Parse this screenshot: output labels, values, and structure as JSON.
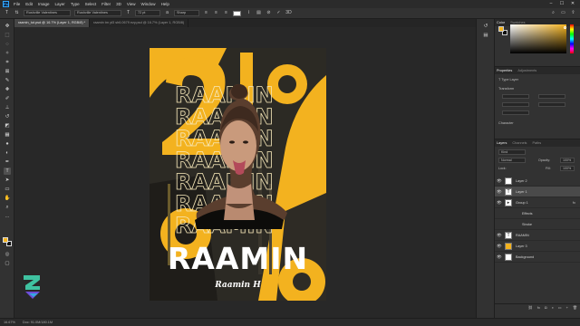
{
  "app": {
    "logo": "Ps",
    "menu": [
      "File",
      "Edit",
      "Image",
      "Layer",
      "Type",
      "Select",
      "Filter",
      "3D",
      "View",
      "Window",
      "Help"
    ],
    "window_controls": [
      "–",
      "☐",
      "✕"
    ]
  },
  "options_bar": {
    "font_family": "Rushville Valentines",
    "font_style": "Rushville Valentines",
    "font_size": "72 pt",
    "antialias": "Sharp",
    "text_color": "#ffffff"
  },
  "tabs": [
    {
      "label": "raamin_tut.psd @ 16.7% (Layer 1, RGB/8) *",
      "active": true
    },
    {
      "label": "raamin tm yt3 sh6.0679 ezy.psd @ 16.7% (Layer 1, RGB/8)",
      "active": false
    }
  ],
  "poster": {
    "title": "RAAMIN",
    "signature": "Raamin H",
    "bg_text": "RAAMIN",
    "accent": "#f3b21f"
  },
  "panels": {
    "color_tabs": [
      "Color",
      "Swatches"
    ],
    "properties_tabs": [
      "Properties",
      "Adjustments"
    ],
    "properties_type": "Type Layer",
    "transform_label": "Transform",
    "character_label": "Character",
    "layers_tabs": [
      "Layers",
      "Channels",
      "Paths"
    ],
    "kind_label": "Kind",
    "blend_mode": "Normal",
    "opacity_label": "Opacity:",
    "opacity_value": "100%",
    "lock_label": "Lock:",
    "fill_label": "Fill:",
    "fill_value": "100%"
  },
  "layers": [
    {
      "name": "Layer 2",
      "thumb": "",
      "selected": false,
      "sub": false
    },
    {
      "name": "Layer 1",
      "thumb": "T",
      "selected": true,
      "sub": false
    },
    {
      "name": "Group 1",
      "thumb": "▸",
      "selected": false,
      "sub": false
    },
    {
      "name": "Effects",
      "thumb": "",
      "selected": false,
      "sub": true
    },
    {
      "name": "Stroke",
      "thumb": "",
      "selected": false,
      "sub": true
    },
    {
      "name": "RAAMIN",
      "thumb": "T",
      "selected": false,
      "sub": false
    },
    {
      "name": "Layer 3",
      "thumb": "",
      "selected": false,
      "sub": false
    },
    {
      "name": "Background",
      "thumb": "",
      "selected": false,
      "sub": false
    }
  ],
  "status": {
    "zoom": "16.67%",
    "doc": "Doc: 91.0M/180.1M"
  },
  "icons": {
    "move": "move-icon",
    "marquee": "marquee-icon",
    "lasso": "lasso-icon",
    "wand": "wand-icon",
    "crop": "crop-icon",
    "eyedropper": "eyedropper-icon",
    "heal": "heal-icon",
    "brush": "brush-icon",
    "stamp": "stamp-icon",
    "history": "history-brush-icon",
    "eraser": "eraser-icon",
    "gradient": "gradient-icon",
    "blur": "blur-icon",
    "dodge": "dodge-icon",
    "pen": "pen-icon",
    "type": "type-icon",
    "path": "path-select-icon",
    "shape": "shape-icon",
    "hand": "hand-icon",
    "zoom": "zoom-icon"
  }
}
